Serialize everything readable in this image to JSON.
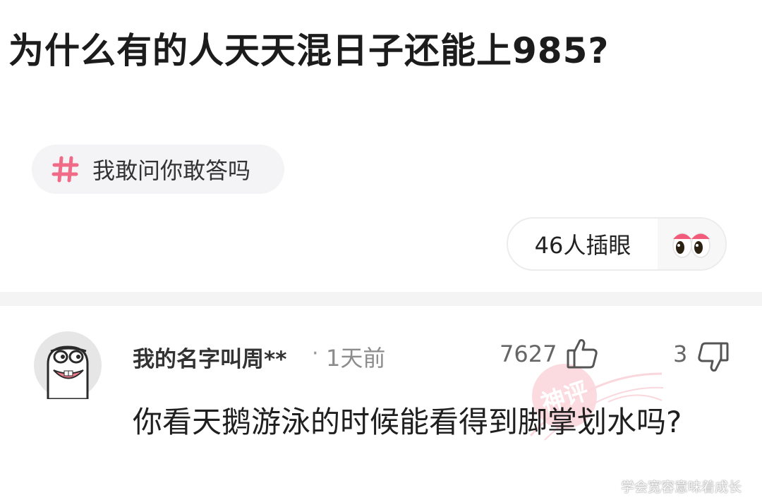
{
  "question": {
    "title": "为什么有的人天天混日子还能上985?"
  },
  "topic": {
    "label": "我敢问你敢答吗"
  },
  "onlookers": {
    "label": "46人插眼"
  },
  "comment": {
    "username": "我的名字叫周**",
    "separator": "·",
    "time_ago": "1天前",
    "like_count": "7627",
    "dislike_count": "3",
    "text": "你看天鹅游泳的时候能看得到脚掌划水吗?",
    "stamp_text": "神评"
  },
  "watermark": {
    "text": "学会宽容意味着成长"
  },
  "colors": {
    "accent_pink": "#f06b88",
    "stamp_pink": "#f7b7c1"
  },
  "icons": {
    "topic": "hash-icon",
    "onlookers": "eyes-icon",
    "like": "thumbs-up-icon",
    "dislike": "thumbs-down-icon"
  }
}
